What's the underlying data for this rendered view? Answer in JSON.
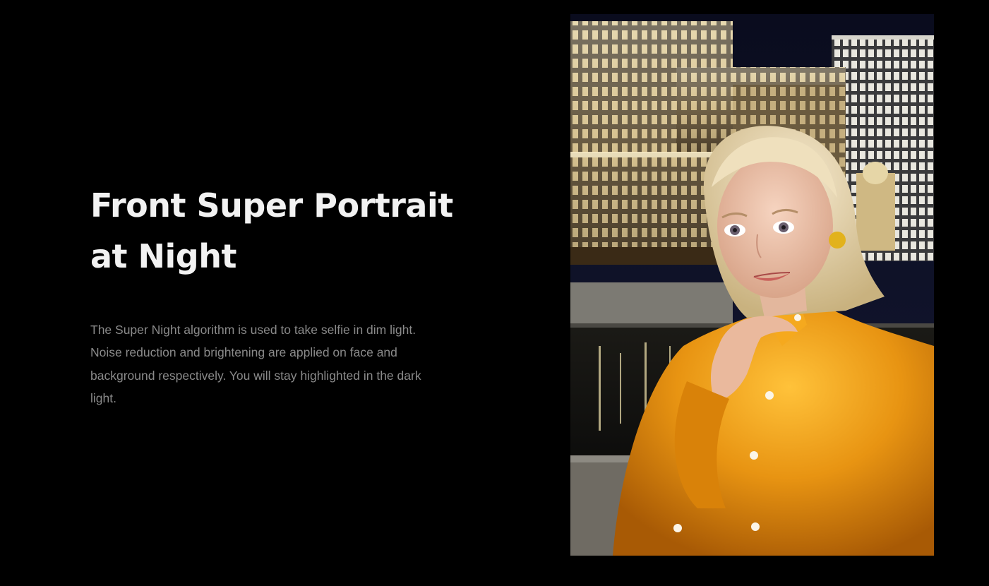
{
  "feature": {
    "title_line1": "Front Super Portrait",
    "title_line2": "at Night",
    "description": "The Super Night algorithm is used to take selfie in dim light. Noise reduction and brightening are applied on face and background respectively. You will stay highlighted in the dark light."
  },
  "colors": {
    "background": "#000000",
    "title": "#f2f2f2",
    "description": "#8a8a8a",
    "shirt": "#e79312",
    "hair": "#e8d7b0"
  }
}
